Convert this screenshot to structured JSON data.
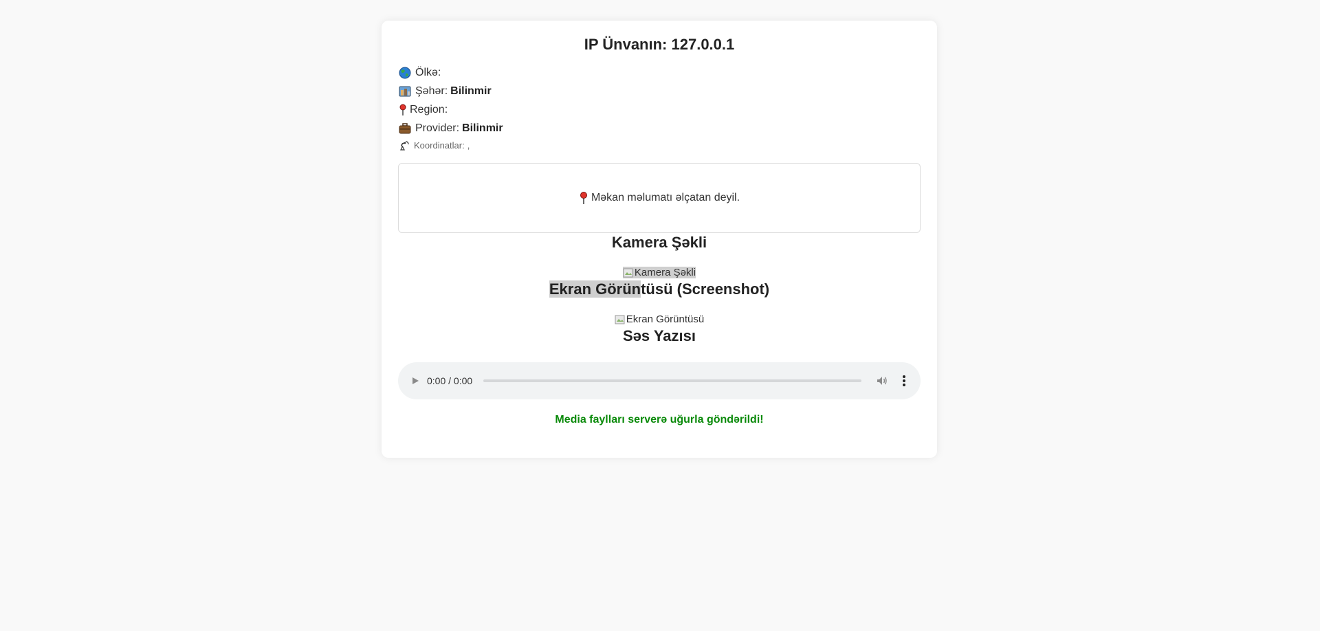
{
  "header": {
    "ip_label": "IP Ünvanın:",
    "ip_value": "127.0.0.1"
  },
  "info": {
    "country_label": "Ölkə:",
    "country_value": "",
    "city_label": "Şəhər:",
    "city_value": "Bilinmir",
    "region_label": "Region:",
    "region_value": "",
    "provider_label": "Provider:",
    "provider_value": "Bilinmir",
    "coords_label": "Koordinatlar:",
    "coords_value": ","
  },
  "map": {
    "message": "Məkan məlumatı əlçatan deyil."
  },
  "camera": {
    "title": "Kamera Şəkli",
    "img_alt": "Kamera Şəkli"
  },
  "screenshot": {
    "title_highlight": "Ekran Görün",
    "title_rest": "tüsü (Screenshot)",
    "img_alt": "Ekran Görüntüsü"
  },
  "audio": {
    "title": "Səs Yazısı",
    "time": "0:00 / 0:00",
    "progress": 0
  },
  "status": {
    "message": "Media faylları serverə uğurla göndərildi!",
    "color": "#0a8a0a"
  },
  "icons": {
    "country": "globe-icon",
    "city": "city-icon",
    "region": "pin-icon",
    "provider": "briefcase-icon",
    "coords": "satellite-icon"
  }
}
